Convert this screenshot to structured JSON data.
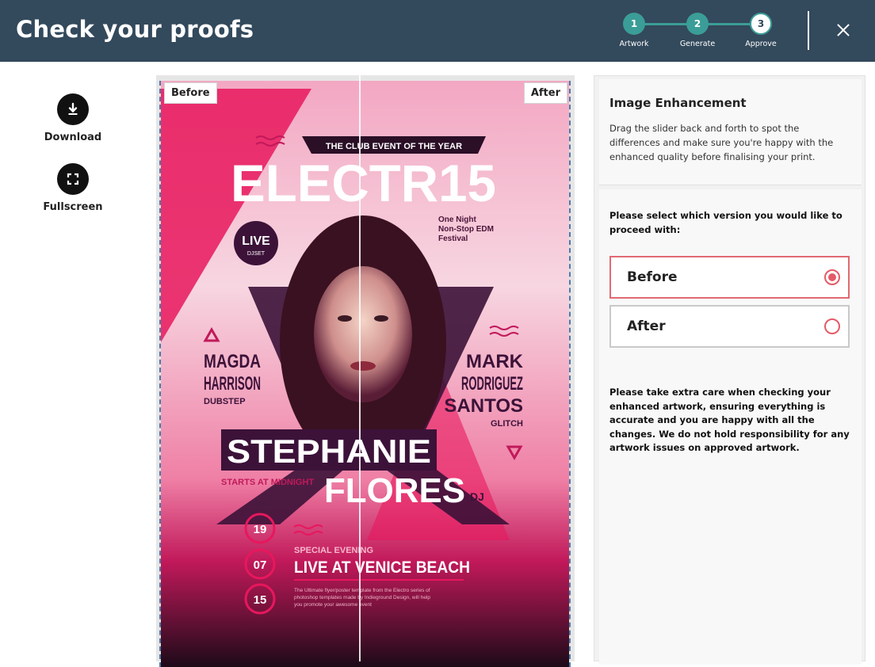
{
  "header": {
    "title": "Check your proofs",
    "steps": [
      {
        "number": "1",
        "label": "Artwork"
      },
      {
        "number": "2",
        "label": "Generate"
      },
      {
        "number": "3",
        "label": "Approve"
      }
    ]
  },
  "tools": {
    "download_label": "Download",
    "fullscreen_label": "Fullscreen"
  },
  "preview": {
    "before_tag": "Before",
    "after_tag": "After",
    "poster": {
      "kicker": "THE CLUB EVENT OF THE YEAR",
      "title": "ELECTR15",
      "subtitle_lines": [
        "One Night",
        "Non-Stop EDM",
        "Festival"
      ],
      "badge_main": "LIVE",
      "badge_sub": "DJSET",
      "left_artist": [
        "MAGDA",
        "HARRISON"
      ],
      "left_genre": "DUBSTEP",
      "right_artist": [
        "MARK",
        "RODRIGUEZ",
        "SANTOS"
      ],
      "right_genre": "GLITCH",
      "headliner_first": "STEPHANIE",
      "headliner_last": "FLORES",
      "dj_suffix": "DJ",
      "start_note": "STARTS AT MIDNIGHT",
      "date_day": "19",
      "date_month": "07",
      "date_year": "15",
      "event_kicker": "SPECIAL EVENING",
      "event_title": "LIVE AT VENICE BEACH",
      "fine_print_lines": [
        "The Ultimate flyer/poster template from the Electro series of",
        "photoshop templates made by Indieground Design, will help",
        "you promote your awesome event"
      ]
    }
  },
  "panel": {
    "title": "Image Enhancement",
    "description": "Drag the slider back and forth to spot the differences and make sure you're happy with the enhanced quality before finalising your print.",
    "select_prompt": "Please select which version you would like to proceed with:",
    "options": [
      {
        "label": "Before",
        "selected": true
      },
      {
        "label": "After",
        "selected": false
      }
    ],
    "warning": "Please take extra care when checking your enhanced artwork, ensuring everything is accurate and you are happy with all the changes. We do not hold responsibility for any artwork issues on approved artwork."
  },
  "colors": {
    "header_bg": "#33495c",
    "step_teal": "#3b9d97",
    "accent_red": "#e45b67",
    "poster_pink": "#e8175d",
    "poster_dark": "#3c1239"
  }
}
